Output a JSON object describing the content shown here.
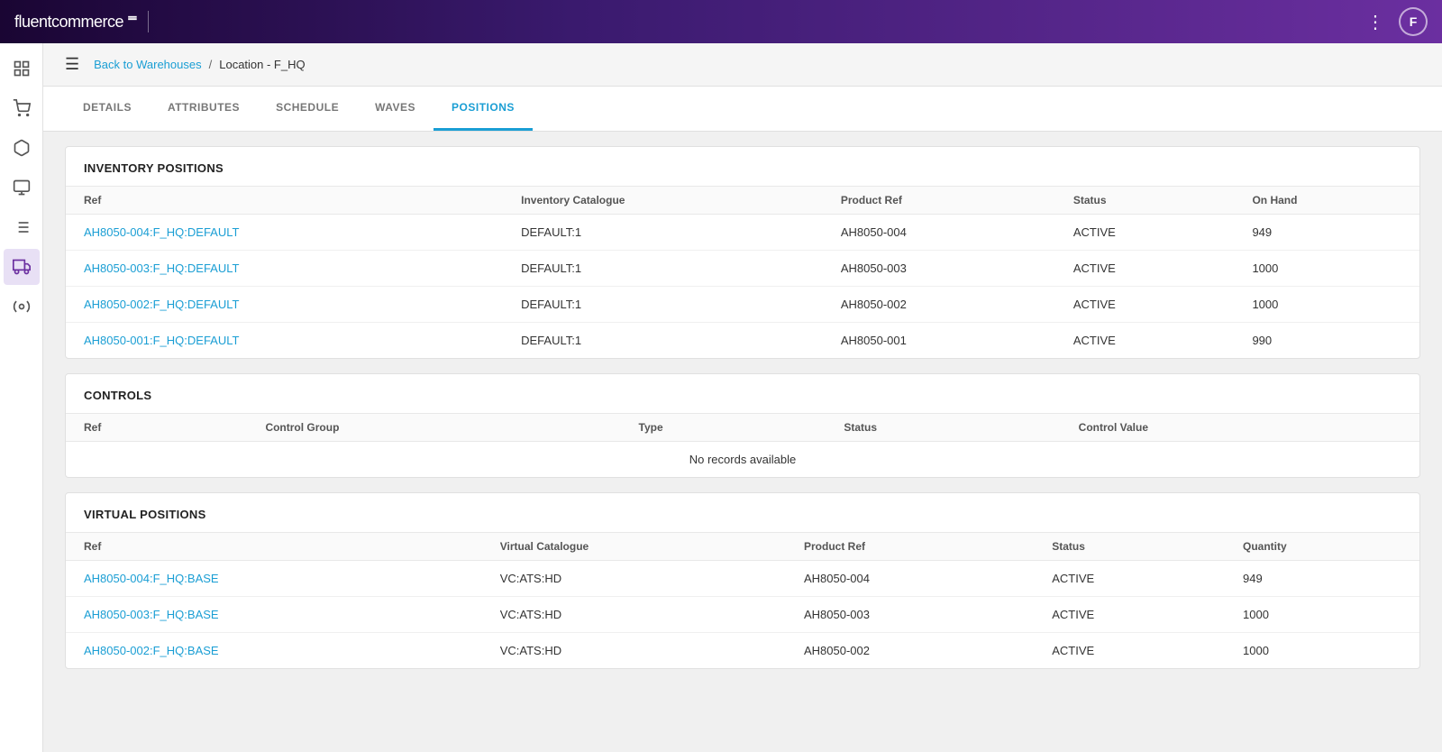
{
  "topbar": {
    "logo_text": "fluentcommerce",
    "logo_symbol": "≡",
    "avatar_initial": "F",
    "more_icon": "⋮"
  },
  "breadcrumb": {
    "back_link": "Back to Warehouses",
    "separator": "/",
    "current_page": "Location - F_HQ"
  },
  "hamburger_icon": "☰",
  "tabs": [
    {
      "label": "DETAILS",
      "active": false
    },
    {
      "label": "ATTRIBUTES",
      "active": false
    },
    {
      "label": "SCHEDULE",
      "active": false
    },
    {
      "label": "WAVES",
      "active": false
    },
    {
      "label": "POSITIONS",
      "active": true
    }
  ],
  "inventory_positions": {
    "title": "INVENTORY POSITIONS",
    "columns": [
      "Ref",
      "Inventory Catalogue",
      "Product Ref",
      "Status",
      "On Hand"
    ],
    "rows": [
      {
        "ref": "AH8050-004:F_HQ:DEFAULT",
        "inventory_catalogue": "DEFAULT:1",
        "product_ref": "AH8050-004",
        "status": "ACTIVE",
        "on_hand": "949"
      },
      {
        "ref": "AH8050-003:F_HQ:DEFAULT",
        "inventory_catalogue": "DEFAULT:1",
        "product_ref": "AH8050-003",
        "status": "ACTIVE",
        "on_hand": "1000"
      },
      {
        "ref": "AH8050-002:F_HQ:DEFAULT",
        "inventory_catalogue": "DEFAULT:1",
        "product_ref": "AH8050-002",
        "status": "ACTIVE",
        "on_hand": "1000"
      },
      {
        "ref": "AH8050-001:F_HQ:DEFAULT",
        "inventory_catalogue": "DEFAULT:1",
        "product_ref": "AH8050-001",
        "status": "ACTIVE",
        "on_hand": "990"
      }
    ]
  },
  "controls": {
    "title": "CONTROLS",
    "columns": [
      "Ref",
      "Control Group",
      "Type",
      "Status",
      "Control Value"
    ],
    "no_records_text": "No records available"
  },
  "virtual_positions": {
    "title": "VIRTUAL POSITIONS",
    "columns": [
      "Ref",
      "Virtual Catalogue",
      "Product Ref",
      "Status",
      "Quantity"
    ],
    "rows": [
      {
        "ref": "AH8050-004:F_HQ:BASE",
        "virtual_catalogue": "VC:ATS:HD",
        "product_ref": "AH8050-004",
        "status": "ACTIVE",
        "quantity": "949"
      },
      {
        "ref": "AH8050-003:F_HQ:BASE",
        "virtual_catalogue": "VC:ATS:HD",
        "product_ref": "AH8050-003",
        "status": "ACTIVE",
        "quantity": "1000"
      },
      {
        "ref": "AH8050-002:F_HQ:BASE",
        "virtual_catalogue": "VC:ATS:HD",
        "product_ref": "AH8050-002",
        "status": "ACTIVE",
        "quantity": "1000"
      }
    ]
  },
  "sidebar": {
    "items": [
      {
        "name": "dashboard-icon",
        "symbol": "▦"
      },
      {
        "name": "cart-icon",
        "symbol": "🛒"
      },
      {
        "name": "package-icon",
        "symbol": "📦"
      },
      {
        "name": "screen-icon",
        "symbol": "🖥"
      },
      {
        "name": "list-icon",
        "symbol": "☰"
      },
      {
        "name": "grid-icon",
        "symbol": "⊞",
        "active": true
      },
      {
        "name": "tools-icon",
        "symbol": "🔧"
      }
    ]
  }
}
